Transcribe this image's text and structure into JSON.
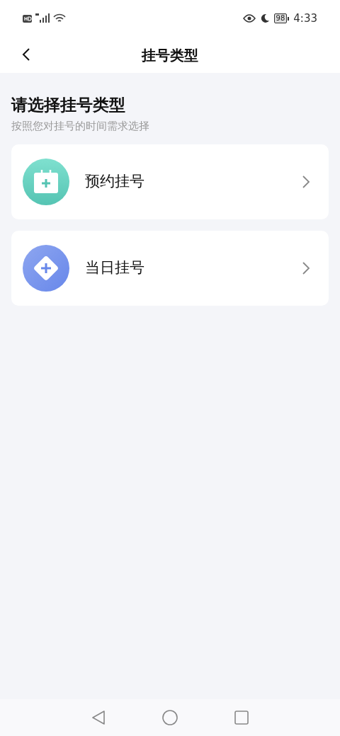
{
  "status_bar": {
    "battery": "98",
    "time": "4:33"
  },
  "header": {
    "title": "挂号类型"
  },
  "heading": "请选择挂号类型",
  "subtitle": "按照您对挂号的时间需求选择",
  "options": [
    {
      "kind": "calendar",
      "label": "预约挂号"
    },
    {
      "kind": "diamond",
      "label": "当日挂号"
    }
  ]
}
